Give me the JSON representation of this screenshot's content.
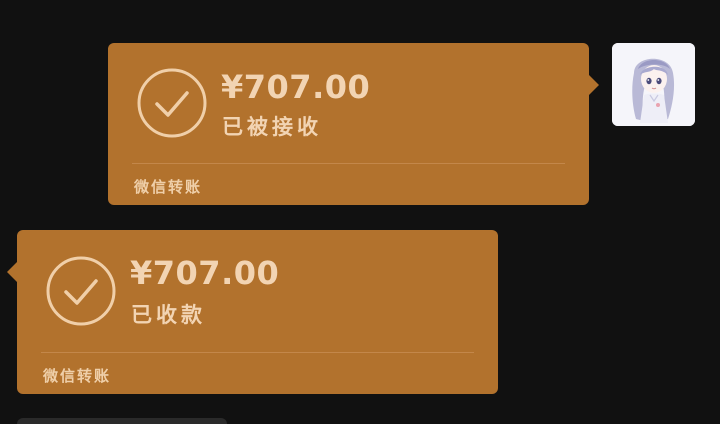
{
  "colors": {
    "background": "#111111",
    "bubble": "#b2722d",
    "text": "#f2d4b3",
    "divider": "#c3874a"
  },
  "messages": [
    {
      "direction": "sent",
      "amount": "¥707.00",
      "status": "已被接收",
      "footer": "微信转账",
      "icon": "check-circle-icon"
    },
    {
      "direction": "received",
      "amount": "¥707.00",
      "status": "已收款",
      "footer": "微信转账",
      "icon": "check-circle-icon"
    }
  ],
  "avatar": {
    "icon": "user-avatar-anime-girl"
  }
}
